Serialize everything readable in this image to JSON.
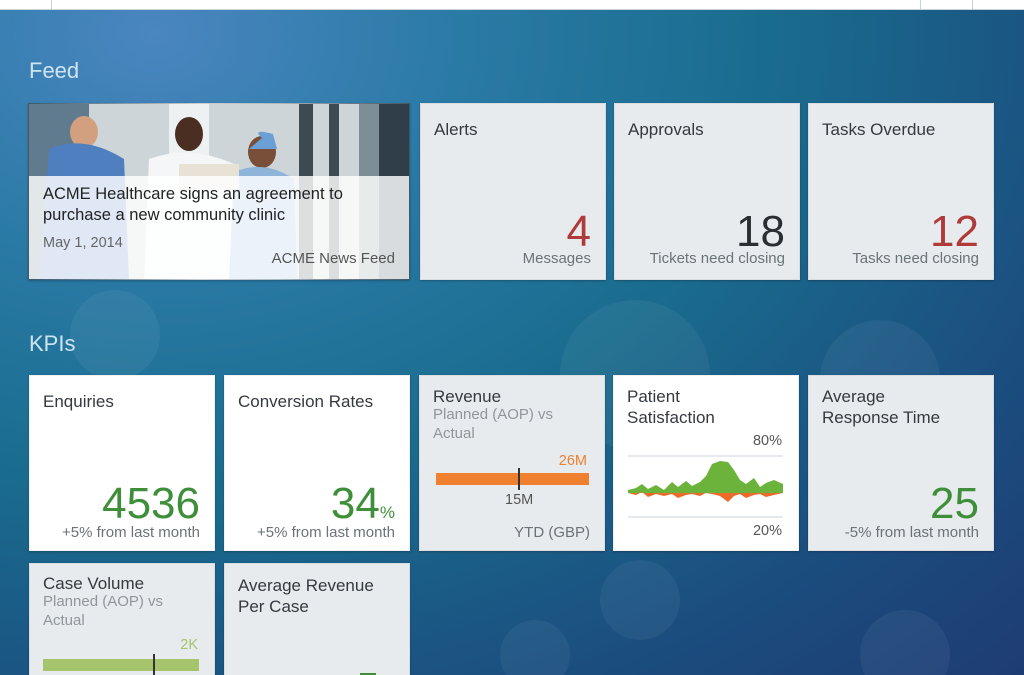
{
  "sections": {
    "feed": "Feed",
    "kpis": "KPIs"
  },
  "news": {
    "headline": "ACME Healthcare signs an agreement to purchase a new community clinic",
    "date": "May 1, 2014",
    "source": "ACME News Feed"
  },
  "alerts": {
    "title": "Alerts",
    "value": "4",
    "footer": "Messages",
    "color": "#b03a3a"
  },
  "approvals": {
    "title": "Approvals",
    "value": "18",
    "footer": "Tickets need closing",
    "color": "#2a2f33"
  },
  "tasks": {
    "title": "Tasks Overdue",
    "value": "12",
    "footer": "Tasks need closing",
    "color": "#b03a3a"
  },
  "enquiries": {
    "title": "Enquiries",
    "value": "4536",
    "footer": "+5% from last month",
    "color": "#3f8f3a"
  },
  "conversion": {
    "title": "Conversion Rates",
    "value": "34",
    "unit": "%",
    "footer": "+5% from last month",
    "color": "#3f8f3a"
  },
  "revenue": {
    "title": "Revenue",
    "subtitle": "Planned (AOP) vs Actual",
    "target_label": "26M",
    "actual_label": "15M",
    "footer": "YTD (GBP)",
    "bar_color": "#ee8030"
  },
  "satisfaction": {
    "title": "Patient Satisfaction",
    "top_label": "80%",
    "bottom_label": "20%",
    "colors": {
      "positive": "#6bb33a",
      "negative": "#ee6a2a"
    }
  },
  "response": {
    "title": "Average Response Time",
    "value": "25",
    "footer": "-5% from last month",
    "color": "#3f8f3a"
  },
  "case_volume": {
    "title": "Case Volume",
    "subtitle": "Planned (AOP) vs Actual",
    "target_label": "2K",
    "bar_color": "#a6c46c"
  },
  "avg_revenue": {
    "title": "Average Revenue Per Case"
  }
}
